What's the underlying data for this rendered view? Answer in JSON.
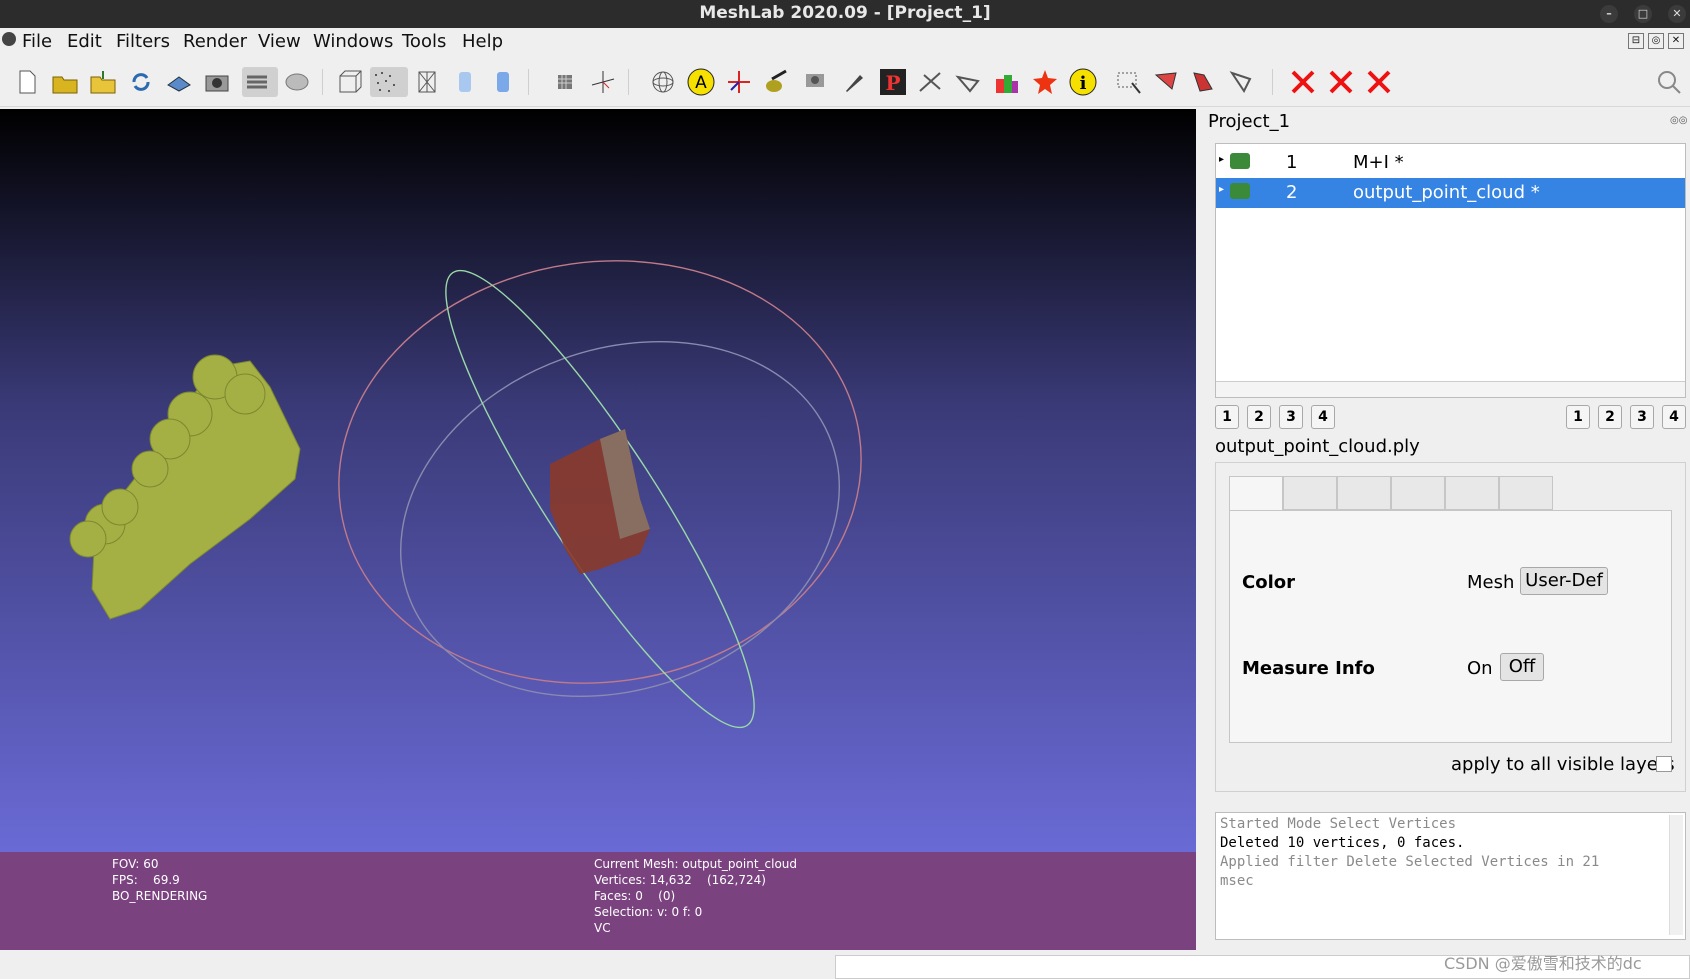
{
  "window": {
    "title": "MeshLab 2020.09 - [Project_1]"
  },
  "menubar": {
    "items": [
      "File",
      "Edit",
      "Filters",
      "Render",
      "View",
      "Windows",
      "Tools",
      "Help"
    ]
  },
  "toolbar": {
    "icons": [
      "new-project",
      "open-project",
      "import-mesh",
      "reload",
      "export-mesh",
      "snapshot",
      "layers",
      "colorize",
      "bounding-box",
      "points",
      "wireframe",
      "flat",
      "smooth",
      "pick",
      "axis",
      "align",
      "trackball",
      "annotate",
      "ortho",
      "paint",
      "tool-a",
      "tool-b",
      "tool-c",
      "tool-d",
      "georef",
      "info",
      "select-verts",
      "select-faces",
      "select-conn",
      "select-zone",
      "delete-verts",
      "delete-faces",
      "delete-all",
      "search"
    ]
  },
  "viewport": {
    "fov": "FOV: 60",
    "fps": "FPS:    69.9",
    "mode": "BO_RENDERING",
    "current_mesh": "Current Mesh: output_point_cloud",
    "vertices": "Vertices: 14,632    (162,724)",
    "faces": "Faces: 0    (0)",
    "selection": "Selection: v: 0 f: 0",
    "vc": "VC"
  },
  "panel": {
    "project": "Project_1",
    "layers": [
      {
        "num": "1",
        "name": "M+I *"
      },
      {
        "num": "2",
        "name": "output_point_cloud *"
      }
    ],
    "left_pages": [
      "1",
      "2",
      "3",
      "4"
    ],
    "right_pages": [
      "1",
      "2",
      "3",
      "4"
    ],
    "selected_file": "output_point_cloud.ply",
    "color_label": "Color",
    "color_mode": "Mesh",
    "color_btn": "User-Def",
    "measure_label": "Measure Info",
    "measure_on": "On",
    "measure_off": "Off",
    "apply_label": "apply to all visible layers"
  },
  "log": {
    "line1": "Started Mode Select Vertices",
    "line2": "Deleted 10 vertices, 0 faces.",
    "line3": "Applied filter Delete Selected Vertices in 21",
    "line4": "msec"
  },
  "watermark": "CSDN @爱傲雪和技术的dc",
  "colors": {
    "title_bg": "#2c2c2c",
    "selected_row": "#3584e4",
    "info_bar": "#7b4280",
    "mesh": "#a4b043"
  }
}
